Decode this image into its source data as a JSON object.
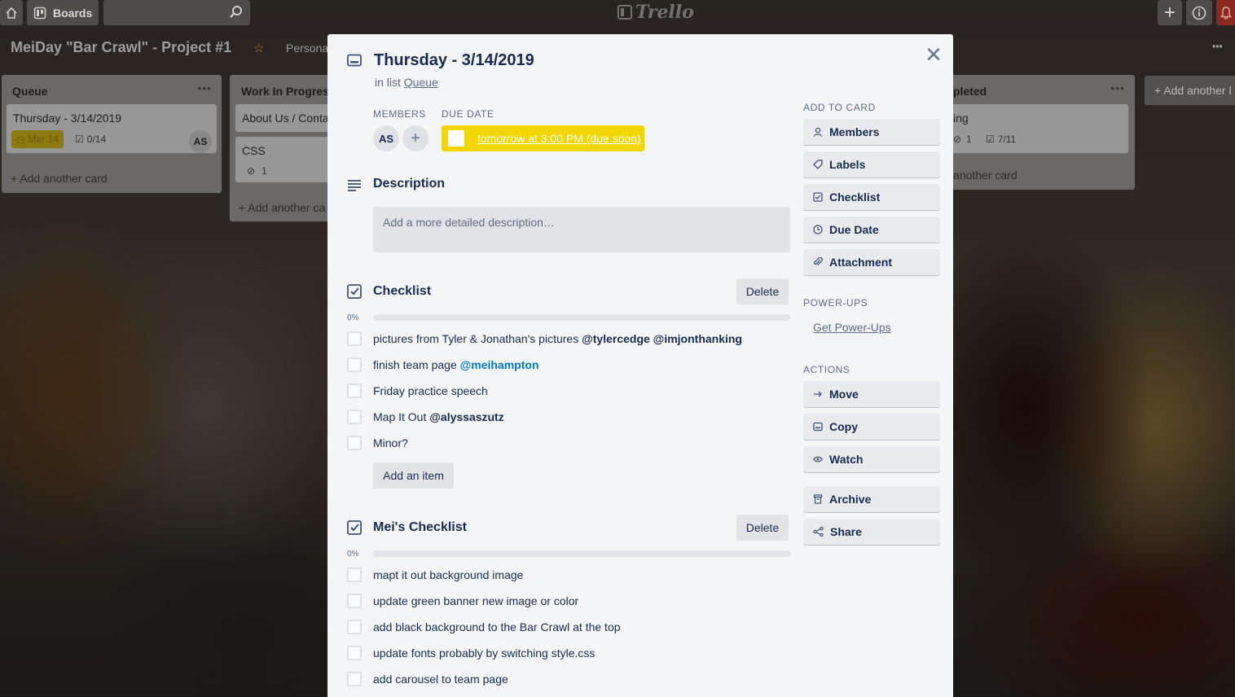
{
  "topbar": {
    "boards_label": "Boards",
    "logo_text": "Trello"
  },
  "board": {
    "title": "MeiDay \"Bar Crawl\" - Project #1",
    "visibility": "Persona"
  },
  "lists": [
    {
      "title": "Queue",
      "cards": [
        {
          "title": "Thursday - 3/14/2019",
          "due_badge": "Mar 14",
          "checklist_badge": "0/14",
          "member": "AS"
        }
      ],
      "add_card": "+ Add another card"
    },
    {
      "title": "Work In Progres",
      "cards": [
        {
          "title": "About Us / Conta"
        },
        {
          "title": "CSS",
          "attachments": "1"
        }
      ],
      "add_card": "+ Add another ca"
    },
    {
      "title": "pleted",
      "cards": [
        {
          "title": "ing",
          "attachments": "1",
          "checklist_badge": "7/11"
        }
      ],
      "add_card": "another card"
    }
  ],
  "add_list": "+ Add another l",
  "modal": {
    "title": "Thursday - 3/14/2019",
    "in_list_prefix": "in list",
    "in_list_name": "Queue",
    "members_label": "Members",
    "due_date_label": "Due Date",
    "member_initials": "AS",
    "due_text": "tomorrow at 3:00 PM (due soon)",
    "description_title": "Description",
    "description_placeholder": "Add a more detailed description…",
    "checklists": [
      {
        "title": "Checklist",
        "delete_label": "Delete",
        "percent": "0%",
        "items": [
          {
            "text": "pictures from Tyler & Jonathan's pictures ",
            "mentions": [
              "@tylercedge",
              "@imjonthanking"
            ]
          },
          {
            "text": "finish team page ",
            "mentions": [
              "@meihampton"
            ]
          },
          {
            "text": "Friday practice speech",
            "mentions": []
          },
          {
            "text": "Map It Out ",
            "mentions": [
              "@alyssaszutz"
            ]
          },
          {
            "text": "Minor?",
            "mentions": []
          }
        ],
        "add_item_label": "Add an item"
      },
      {
        "title": "Mei's Checklist",
        "delete_label": "Delete",
        "percent": "0%",
        "items": [
          {
            "text": "mapt it out background image"
          },
          {
            "text": "update green banner new image or color"
          },
          {
            "text": "add black background to the Bar Crawl at the top"
          },
          {
            "text": "update fonts probably by switching style.css"
          },
          {
            "text": "add carousel to team page"
          }
        ]
      }
    ],
    "sidebar": {
      "add_to_card_label": "Add to card",
      "add_to_card": [
        "Members",
        "Labels",
        "Checklist",
        "Due Date",
        "Attachment"
      ],
      "powerups_label": "Power-Ups",
      "powerups_link": "Get Power-Ups",
      "actions_label": "Actions",
      "actions": [
        "Move",
        "Copy",
        "Watch",
        "Archive",
        "Share"
      ]
    }
  },
  "colors": {
    "due_soon": "#f2d600",
    "mention_blue": "#0079bf",
    "modal_bg": "#f4f5f7"
  }
}
